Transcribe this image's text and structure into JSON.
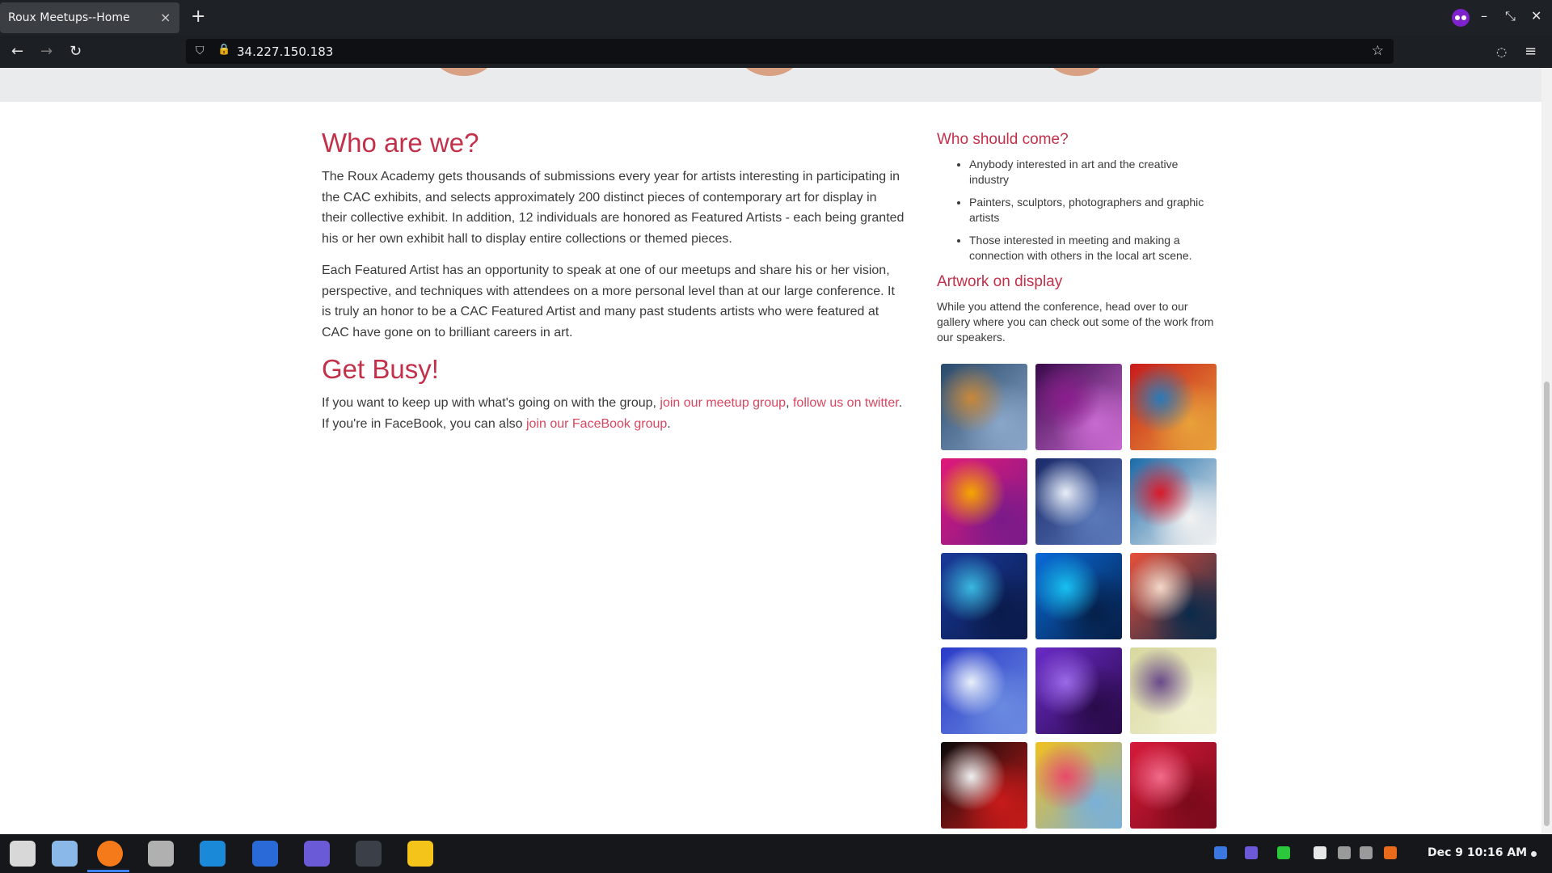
{
  "browser": {
    "tab_title": "Roux Meetups--Home",
    "tab_close": "×",
    "new_tab": "+",
    "url": "34.227.150.183",
    "back_glyph": "←",
    "forward_glyph": "→",
    "reload_glyph": "↻",
    "shield_glyph": "⛉",
    "lock_glyph": "🔒",
    "star_glyph": "☆",
    "pocket_glyph": "◌",
    "menu_glyph": "≡",
    "minimize_glyph": "–",
    "restore_glyph": "⤡",
    "close_glyph": "✕"
  },
  "main": {
    "heading1": "Who are we?",
    "para1": "The Roux Academy gets thousands of submissions every year for artists interesting in participating in the CAC exhibits, and selects approximately 200 distinct pieces of contemporary art for display in their collective exhibit. In addition, 12 individuals are honored as Featured Artists - each being granted his or her own exhibit hall to display entire collections or themed pieces.",
    "para2": "Each Featured Artist has an opportunity to speak at one of our meetups and share his or her vision, perspective, and techniques with attendees on a more personal level than at our large conference. It is truly an honor to be a CAC Featured Artist and many past students artists who were featured at CAC have gone on to brilliant careers in art.",
    "heading2": "Get Busy!",
    "busy_text_1": "If you want to keep up with what's going on with the group, ",
    "busy_link_meetup": "join our meetup group",
    "busy_sep": ", ",
    "busy_link_twitter": "follow us on twitter",
    "busy_text_2": ". If you're in FaceBook, you can also ",
    "busy_link_facebook": "join our FaceBook group",
    "busy_text_3": "."
  },
  "aside": {
    "who_heading": "Who should come?",
    "who_items": [
      "Anybody interested in art and the creative industry",
      "Painters, sculptors, photographers and graphic artists",
      "Those interested in meeting and making a connection with others in the local art scene."
    ],
    "art_heading": "Artwork on display",
    "art_desc": "While you attend the conference, head over to our gallery where you can check out some of the work from our speakers."
  },
  "gallery": [
    {
      "name": "artwork-1",
      "colors": [
        "#2a4a6b",
        "#c8883a",
        "#8aa6c8"
      ]
    },
    {
      "name": "artwork-2",
      "colors": [
        "#3a0a4a",
        "#8a1c8c",
        "#c86ad0"
      ]
    },
    {
      "name": "artwork-3",
      "colors": [
        "#c81a1a",
        "#2a7ab8",
        "#e8a13a"
      ]
    },
    {
      "name": "artwork-4",
      "colors": [
        "#e0197a",
        "#f5a600",
        "#7a1a8a"
      ]
    },
    {
      "name": "artwork-5",
      "colors": [
        "#1a2a6a",
        "#e8eef8",
        "#5a78b8"
      ]
    },
    {
      "name": "artwork-6",
      "colors": [
        "#1a6aa8",
        "#d81a2a",
        "#f2f2f2"
      ]
    },
    {
      "name": "artwork-7",
      "colors": [
        "#1a3a9a",
        "#3ab8e0",
        "#0a1a4a"
      ]
    },
    {
      "name": "artwork-8",
      "colors": [
        "#0a6ad8",
        "#18c0f0",
        "#06204a"
      ]
    },
    {
      "name": "artwork-9",
      "colors": [
        "#e8503a",
        "#f2d8c8",
        "#0a2a4a"
      ]
    },
    {
      "name": "artwork-10",
      "colors": [
        "#2a3ac8",
        "#e8f0fa",
        "#6a8ae0"
      ]
    },
    {
      "name": "artwork-11",
      "colors": [
        "#6a2ac8",
        "#9a6ae8",
        "#2a0a4a"
      ]
    },
    {
      "name": "artwork-12",
      "colors": [
        "#d8d8a0",
        "#6a4a8a",
        "#f0f0d0"
      ]
    },
    {
      "name": "artwork-13",
      "colors": [
        "#0a0a0a",
        "#f0f0f0",
        "#c81a1a"
      ]
    },
    {
      "name": "artwork-14",
      "colors": [
        "#f0c020",
        "#e84a6a",
        "#7ab0d8"
      ]
    },
    {
      "name": "artwork-15",
      "colors": [
        "#d81a3a",
        "#f26a8a",
        "#7a0a1a"
      ]
    }
  ],
  "taskbar": {
    "icons": [
      {
        "name": "zorin-menu-icon",
        "color": "#d8d8d8"
      },
      {
        "name": "workspaces-icon",
        "color": "#8ab8e8"
      },
      {
        "name": "firefox-icon",
        "color": "#f57a1a"
      },
      {
        "name": "files-icon",
        "color": "#b0b0b0"
      },
      {
        "name": "software-store-icon",
        "color": "#1a8ad8"
      },
      {
        "name": "app-p-icon",
        "color": "#2a6ad8"
      },
      {
        "name": "teams-icon",
        "color": "#6a5ad8"
      },
      {
        "name": "terminal-icon",
        "color": "#3a3f48"
      },
      {
        "name": "text-editor-icon",
        "color": "#f5c41a"
      }
    ],
    "tray": [
      {
        "name": "app-tray-icon",
        "color": "#3a78e0"
      },
      {
        "name": "teams-tray-icon",
        "color": "#6a5ad8"
      },
      {
        "name": "green-tray-icon",
        "color": "#2ac83a"
      },
      {
        "name": "wifi-icon",
        "color": "#e8e8e8"
      },
      {
        "name": "volume-icon",
        "color": "#9a9a9a"
      },
      {
        "name": "microphone-icon",
        "color": "#9a9a9a"
      },
      {
        "name": "battery-icon",
        "color": "#e86a1a"
      }
    ],
    "clock": "Dec 9  10:16 AM"
  },
  "colors": {
    "accent": "#c3304a",
    "link": "#d8465f"
  }
}
